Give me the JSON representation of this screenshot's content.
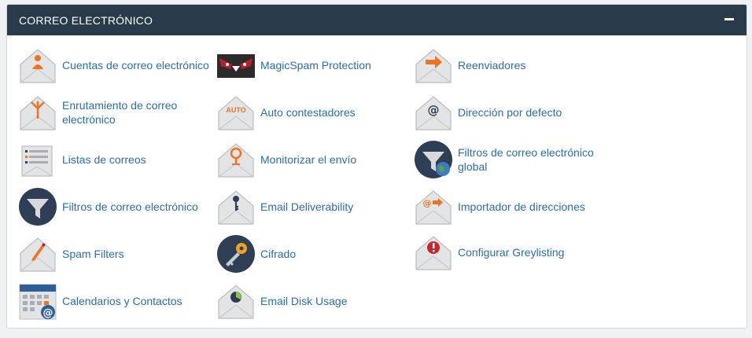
{
  "panel": {
    "title": "CORREO ELECTRÓNICO",
    "collapse_icon": "minus-icon"
  },
  "colors": {
    "header_bg": "#293a4a",
    "link": "#2b6ea8",
    "accent_orange": "#f3711f",
    "envelope_gray": "#e8e9ea",
    "dark_circle": "#2e3e55"
  },
  "items": [
    {
      "label": "Cuentas de correo electrónico",
      "icon": "email-accounts-icon"
    },
    {
      "label": "MagicSpam Protection",
      "icon": "magicspam-icon"
    },
    {
      "label": "Reenviadores",
      "icon": "forwarders-icon"
    },
    {
      "label": "Enrutamiento de correo electrónico",
      "icon": "email-routing-icon"
    },
    {
      "label": "Auto contestadores",
      "icon": "autoresponders-icon",
      "icon_text": "AUTO"
    },
    {
      "label": "Dirección por defecto",
      "icon": "default-address-icon"
    },
    {
      "label": "Listas de correos",
      "icon": "mailing-lists-icon"
    },
    {
      "label": "Monitorizar el envío",
      "icon": "track-delivery-icon"
    },
    {
      "label": "Filtros de correo electrónico global",
      "icon": "global-filters-icon"
    },
    {
      "label": "Filtros de correo electrónico",
      "icon": "email-filters-icon"
    },
    {
      "label": "Email Deliverability",
      "icon": "email-deliverability-icon"
    },
    {
      "label": "Importador de direcciones",
      "icon": "address-importer-icon"
    },
    {
      "label": "Spam Filters",
      "icon": "spam-filters-icon"
    },
    {
      "label": "Cifrado",
      "icon": "encryption-icon"
    },
    {
      "label": "Configurar Greylisting",
      "icon": "greylisting-icon"
    },
    {
      "label": "Calendarios y Contactos",
      "icon": "calendars-contacts-icon"
    },
    {
      "label": "Email Disk Usage",
      "icon": "email-disk-usage-icon"
    }
  ]
}
